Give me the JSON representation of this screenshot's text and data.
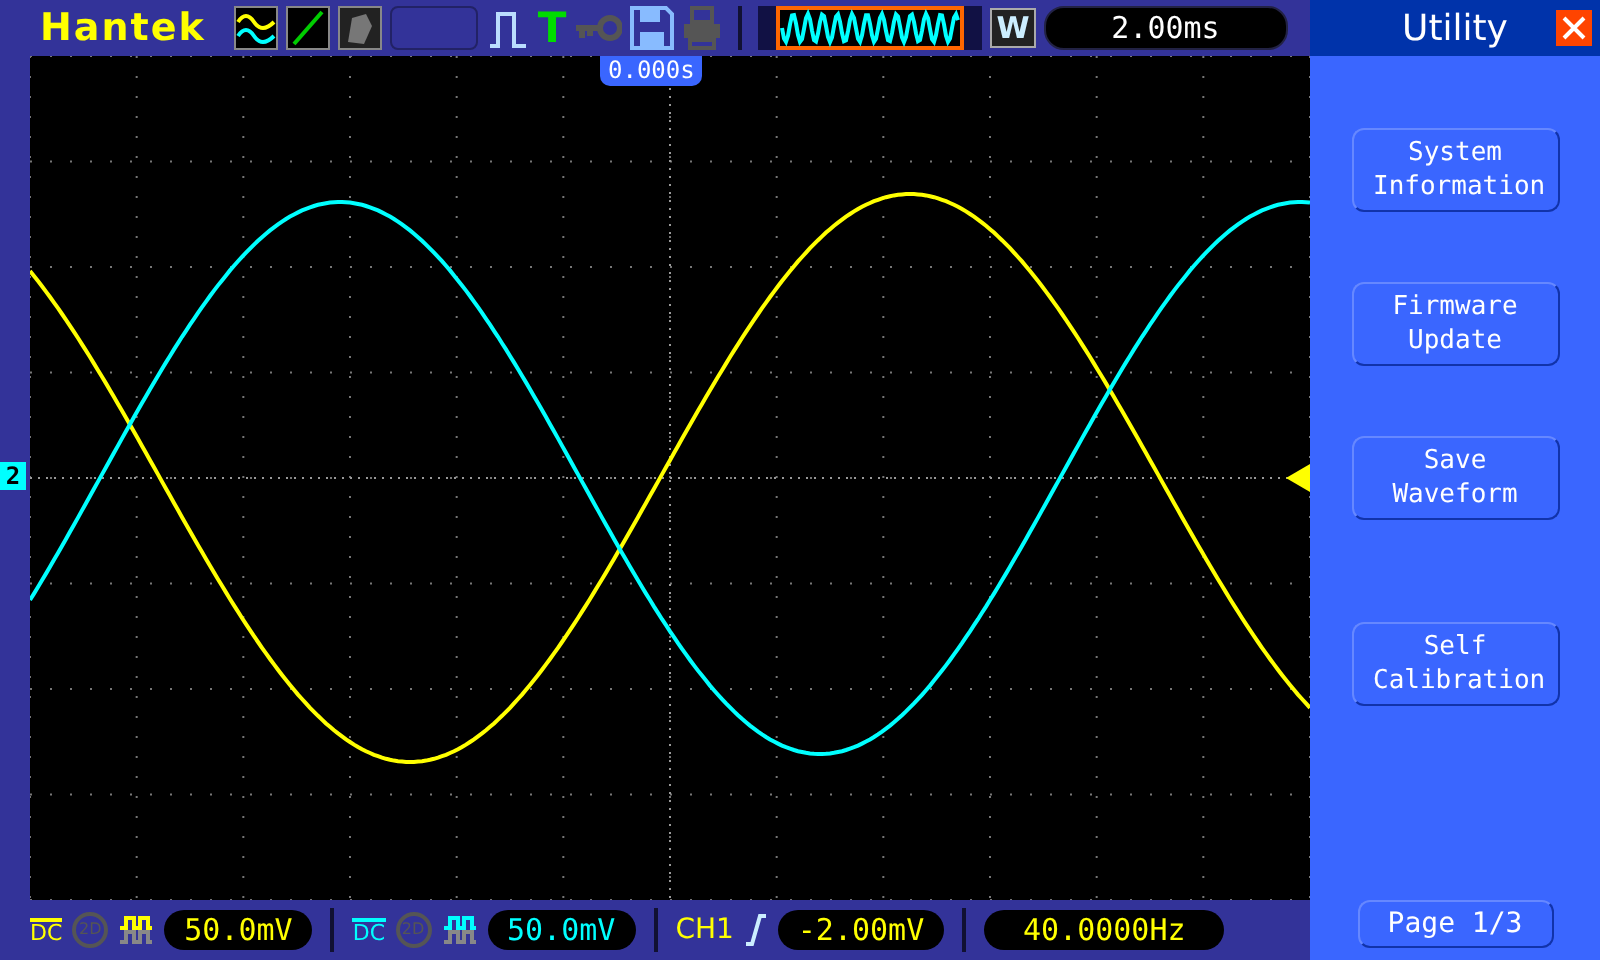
{
  "top_bar": {
    "brand": "Hantek",
    "timebase_mark": "W",
    "timebase": "2.00ms",
    "trigger_mode": "T"
  },
  "screen": {
    "trigger_position": "0.000s",
    "channel_marker": "2"
  },
  "menu": {
    "title": "Utility",
    "buttons": [
      {
        "label": "System Information"
      },
      {
        "label": "Firmware Update"
      },
      {
        "label": "Save Waveform"
      },
      {
        "label": "Self Calibration"
      }
    ],
    "page": "Page 1/3"
  },
  "channels": [
    {
      "coupling": "DC",
      "bandwidth": "2D",
      "scale": "50.0mV",
      "color": "#ffff00"
    },
    {
      "coupling": "DC",
      "bandwidth": "2D",
      "scale": "50.0mV",
      "color": "#00ffff"
    }
  ],
  "trigger": {
    "source": "CH1",
    "level": "-2.00mV"
  },
  "frequency": "40.0000Hz"
}
